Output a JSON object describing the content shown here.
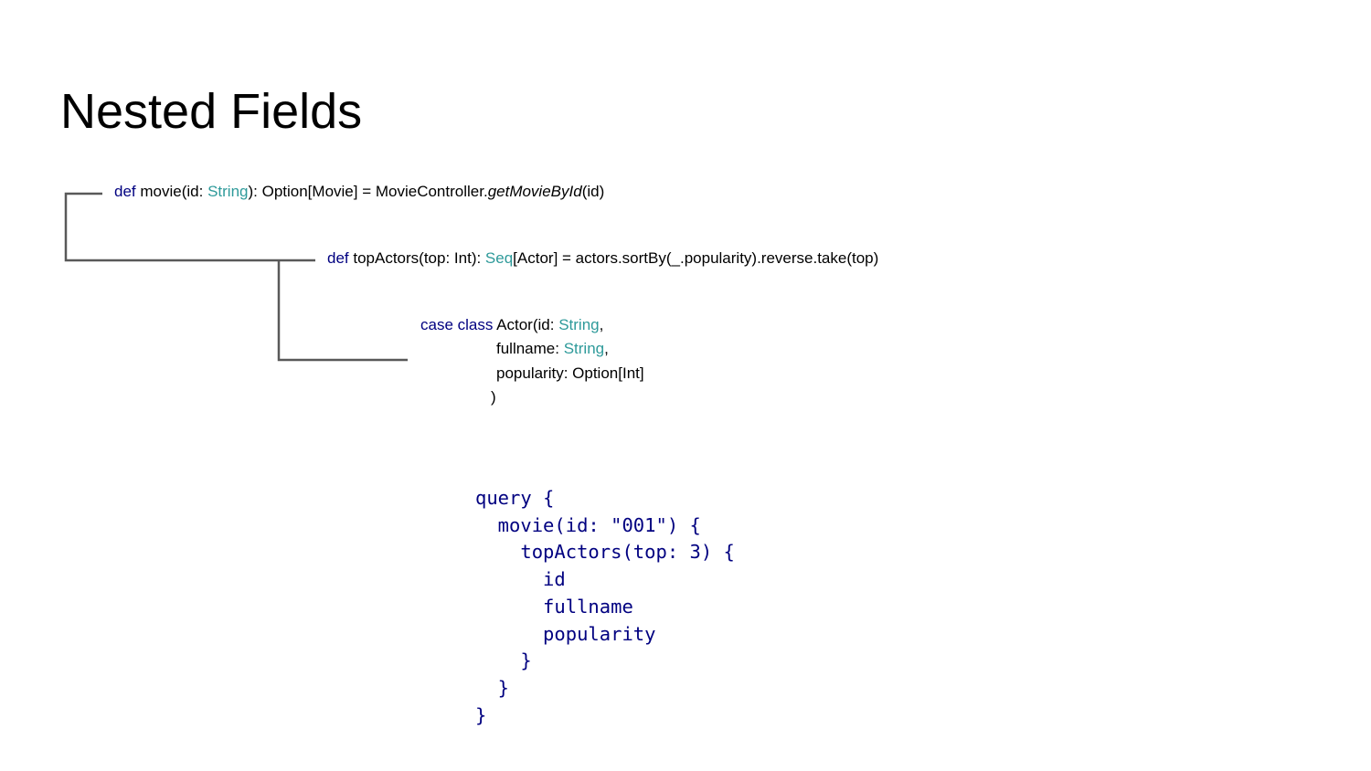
{
  "title": "Nested Fields",
  "snippets": {
    "movie": {
      "kw_def": "def",
      "t1": " movie(id: ",
      "type1": "String",
      "t2": "): Option[Movie] = MovieController.",
      "method": "getMovieById",
      "t3": "(id)"
    },
    "top_actors": {
      "kw_def": "def",
      "t1": " topActors(top: Int): ",
      "type1": "Seq",
      "t2": "[Actor] = actors.sortBy(_.popularity).reverse.take(top)"
    },
    "actor_class": {
      "kw": "case class",
      "t1": " Actor(id: ",
      "type1": "String",
      "t1b": ",",
      "l2_name": "fullname: ",
      "type2": "String",
      "l2_end": ",",
      "l3": "popularity: Option[Int]",
      "l4": ")"
    }
  },
  "graphql_query": [
    "query {",
    "  movie(id: \"001\") {",
    "    topActors(top: 3) {",
    "      id",
    "      fullname",
    "      popularity",
    "    }",
    "  }",
    "}"
  ],
  "colors": {
    "keyword": "#000080",
    "type": "#2e9a9a",
    "connector": "#595959"
  }
}
